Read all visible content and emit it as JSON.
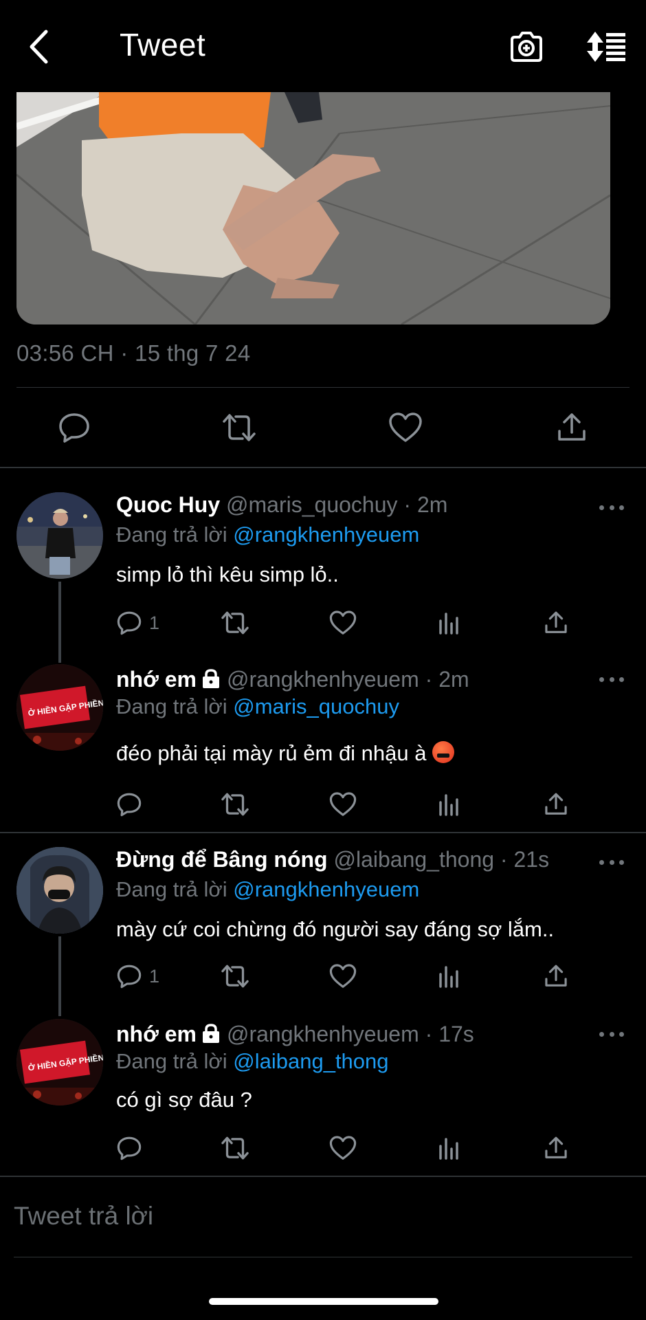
{
  "header": {
    "title": "Tweet"
  },
  "tweet": {
    "timestamp": "03:56 CH · 15 thg 7 24"
  },
  "replies": [
    {
      "name": "Quoc Huy",
      "handle": "@maris_quochuy · 2m",
      "replying_prefix": "Đang trả lời",
      "replying_to": "@rangkhenhyeuem",
      "text": "simp lỏ thì kêu simp lỏ..",
      "reply_count": "1"
    },
    {
      "name": "nhớ em",
      "handle": "@rangkhenhyeuem · 2m",
      "replying_prefix": "Đang trả lời",
      "replying_to": "@maris_quochuy",
      "text": "đéo phải tại mày rủ ẻm đi nhậu à",
      "reply_count": ""
    },
    {
      "name": "Đừng để Bâng nóng",
      "handle": "@laibang_thong · 21s",
      "replying_prefix": "Đang trả lời",
      "replying_to": "@rangkhenhyeuem",
      "text": "mày cứ coi chừng đó người say đáng sợ lắm..",
      "reply_count": "1"
    },
    {
      "name": "nhớ em",
      "handle": "@rangkhenhyeuem · 17s",
      "replying_prefix": "Đang trả lời",
      "replying_to": "@laibang_thong",
      "text": "có gì sợ đâu ?",
      "reply_count": ""
    }
  ],
  "avatar_sign_text": "Ở HIỀN GẶP PHIỀN",
  "composer": {
    "placeholder": "Tweet trả lời"
  },
  "colors": {
    "accent": "#1d9bf0",
    "muted": "#71767b",
    "background": "#000000",
    "divider": "#2f3336"
  }
}
